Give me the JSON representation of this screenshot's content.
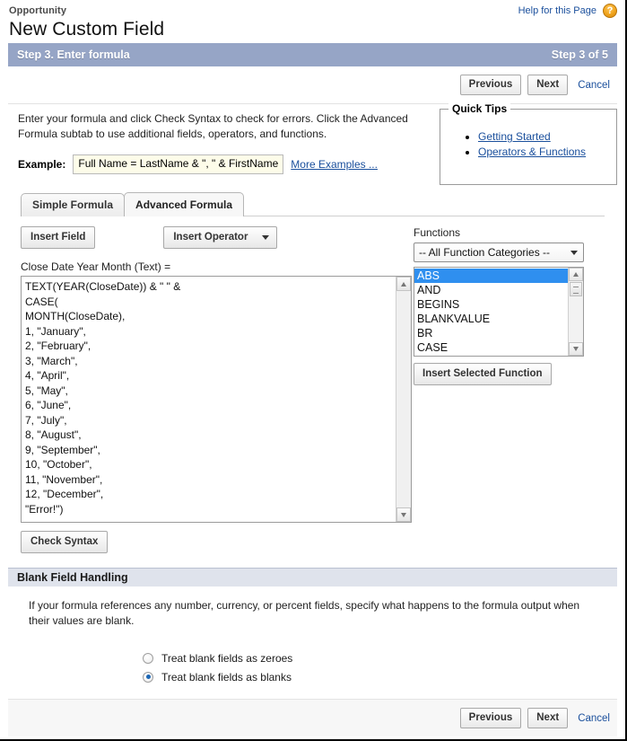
{
  "header": {
    "object_name": "Opportunity",
    "page_title": "New Custom Field",
    "help_link": "Help for this Page",
    "help_icon": "question-mark-icon"
  },
  "step_bar": {
    "title": "Step 3. Enter formula",
    "progress": "Step 3 of 5"
  },
  "toolbar": {
    "previous_label": "Previous",
    "next_label": "Next",
    "cancel_label": "Cancel"
  },
  "intro": {
    "text": "Enter your formula and click Check Syntax to check for errors. Click the Advanced Formula subtab to use additional fields, operators, and functions.",
    "example_label": "Example:",
    "example_value": "Full Name = LastName & \", \" & FirstName",
    "more_examples": "More Examples ..."
  },
  "quick_tips": {
    "legend": "Quick Tips",
    "links": [
      "Getting Started",
      "Operators & Functions"
    ]
  },
  "tabs": [
    {
      "label": "Simple Formula",
      "active": false
    },
    {
      "label": "Advanced Formula",
      "active": true
    }
  ],
  "editor": {
    "insert_field_label": "Insert Field",
    "insert_operator_label": "Insert Operator",
    "insert_operator_caret": "chevron-down-icon",
    "formula_label": "Close Date Year Month (Text) =",
    "formula_value": "TEXT(YEAR(CloseDate)) & \" \" &\nCASE(\nMONTH(CloseDate),\n1, \"January\",\n2, \"February\",\n3, \"March\",\n4, \"April\",\n5, \"May\",\n6, \"June\",\n7, \"July\",\n8, \"August\",\n9, \"September\",\n10, \"October\",\n11, \"November\",\n12, \"December\",\n\"Error!\")",
    "check_syntax_label": "Check Syntax"
  },
  "functions_panel": {
    "title": "Functions",
    "category_selected": "-- All Function Categories --",
    "category_caret": "chevron-down-icon",
    "items": [
      "ABS",
      "AND",
      "BEGINS",
      "BLANKVALUE",
      "BR",
      "CASE"
    ],
    "selected_item": "ABS",
    "insert_function_label": "Insert Selected Function"
  },
  "blank_field_handling": {
    "section_title": "Blank Field Handling",
    "description": "If your formula references any number, currency, or percent fields, specify what happens to the formula output when their values are blank.",
    "options": [
      {
        "label": "Treat blank fields as zeroes",
        "checked": false
      },
      {
        "label": "Treat blank fields as blanks",
        "checked": true
      }
    ]
  },
  "colors": {
    "step_bar_bg": "#96a5c6",
    "section_bar_bg": "#dfe3ec",
    "link": "#1a4f9c",
    "selection": "#2f8fef",
    "example_bg": "#fdfce9",
    "help_icon": "#f0a41d"
  }
}
